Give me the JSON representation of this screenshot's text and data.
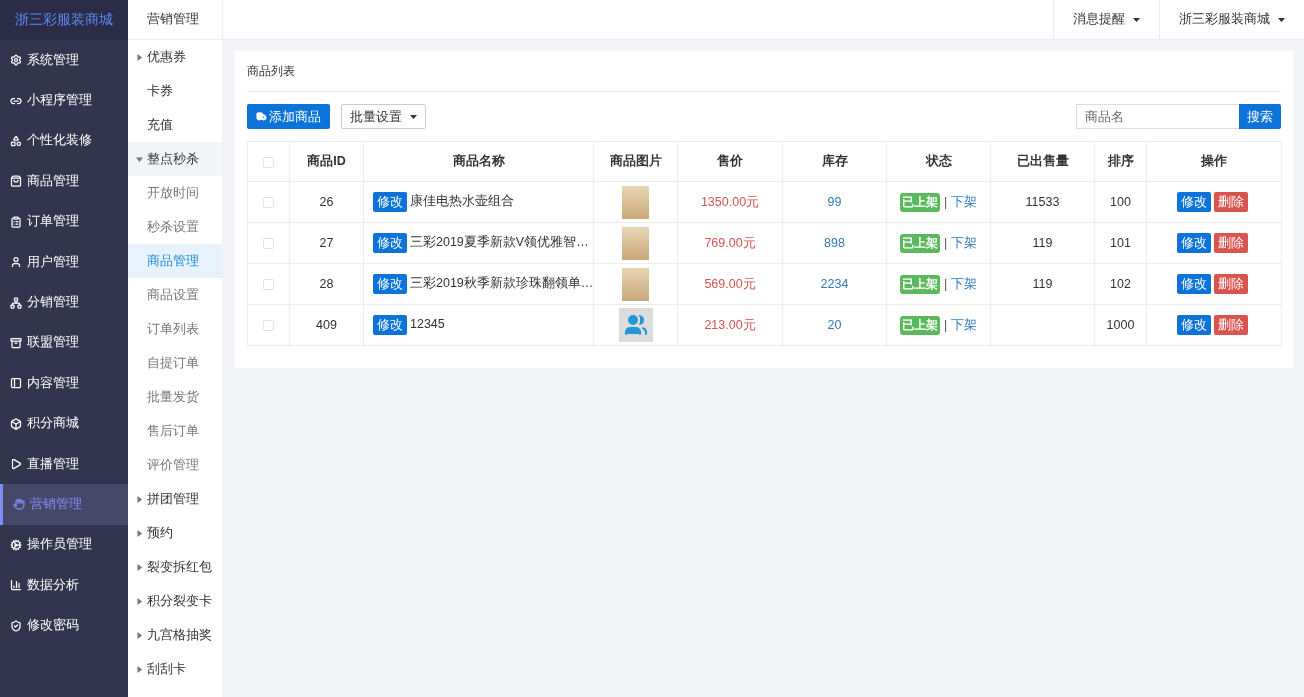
{
  "brand": "浙三彩服装商城",
  "sidebar": {
    "items": [
      {
        "label": "系统管理",
        "selected": false
      },
      {
        "label": "小程序管理",
        "selected": false
      },
      {
        "label": "个性化装修",
        "selected": false
      },
      {
        "label": "商品管理",
        "selected": false
      },
      {
        "label": "订单管理",
        "selected": false
      },
      {
        "label": "用户管理",
        "selected": false
      },
      {
        "label": "分销管理",
        "selected": false
      },
      {
        "label": "联盟管理",
        "selected": false
      },
      {
        "label": "内容管理",
        "selected": false
      },
      {
        "label": "积分商城",
        "selected": false
      },
      {
        "label": "直播管理",
        "selected": false
      },
      {
        "label": "营销管理",
        "selected": true
      },
      {
        "label": "操作员管理",
        "selected": false
      },
      {
        "label": "数据分析",
        "selected": false
      },
      {
        "label": "修改密码",
        "selected": false
      }
    ]
  },
  "submenu": {
    "title": "营销管理",
    "items": [
      {
        "kind": "group",
        "label": "优惠券",
        "expanded": false
      },
      {
        "kind": "link",
        "label": "卡券",
        "selected": false
      },
      {
        "kind": "link",
        "label": "充值",
        "selected": false
      },
      {
        "kind": "group",
        "label": "整点秒杀",
        "expanded": true,
        "children": [
          {
            "label": "开放时间",
            "selected": false
          },
          {
            "label": "秒杀设置",
            "selected": false
          },
          {
            "label": "商品管理",
            "selected": true
          },
          {
            "label": "商品设置",
            "selected": false
          },
          {
            "label": "订单列表",
            "selected": false
          },
          {
            "label": "自提订单",
            "selected": false
          },
          {
            "label": "批量发货",
            "selected": false
          },
          {
            "label": "售后订单",
            "selected": false
          },
          {
            "label": "评价管理",
            "selected": false
          }
        ]
      },
      {
        "kind": "group",
        "label": "拼团管理",
        "expanded": false
      },
      {
        "kind": "group",
        "label": "预约",
        "expanded": false
      },
      {
        "kind": "group",
        "label": "裂变拆红包",
        "expanded": false
      },
      {
        "kind": "group",
        "label": "积分裂变卡",
        "expanded": false
      },
      {
        "kind": "group",
        "label": "九宫格抽奖",
        "expanded": false
      },
      {
        "kind": "group",
        "label": "刮刮卡",
        "expanded": false
      }
    ]
  },
  "topbar": {
    "menus": [
      "消息提醒",
      "浙三彩服装商城"
    ]
  },
  "panel": {
    "title": "商品列表",
    "add_button": "添加商品",
    "batch_button": "批量设置",
    "search": {
      "placeholder": "商品名",
      "button": "搜索"
    },
    "table": {
      "all_checked": false,
      "columns": [
        "商品ID",
        "商品名称",
        "商品图片",
        "售价",
        "库存",
        "状态",
        "已出售量",
        "排序",
        "操作"
      ],
      "rows": [
        {
          "kind": "photo",
          "checked": false,
          "id": "26",
          "edit": "修改",
          "name": "康佳电热水壶组合",
          "price": "1350.00元",
          "stock": "99",
          "status": "已上架",
          "separator": "|",
          "toggle": "下架",
          "sold": "11533",
          "sort": "100",
          "actions": [
            "修改",
            "删除"
          ]
        },
        {
          "kind": "photo",
          "checked": false,
          "id": "27",
          "edit": "修改",
          "name": "三彩2019夏季新款V领优雅智…",
          "price": "769.00元",
          "stock": "898",
          "status": "已上架",
          "separator": "|",
          "toggle": "下架",
          "sold": "119",
          "sort": "101",
          "actions": [
            "修改",
            "删除"
          ]
        },
        {
          "kind": "photo",
          "checked": false,
          "id": "28",
          "edit": "修改",
          "name": "三彩2019秋季新款珍珠翻领单…",
          "price": "569.00元",
          "stock": "2234",
          "status": "已上架",
          "separator": "|",
          "toggle": "下架",
          "sold": "119",
          "sort": "102",
          "actions": [
            "修改",
            "删除"
          ]
        },
        {
          "kind": "avatar",
          "checked": false,
          "id": "409",
          "edit": "修改",
          "name": "12345",
          "price": "213.00元",
          "stock": "20",
          "status": "已上架",
          "separator": "|",
          "toggle": "下架",
          "sort": "1000",
          "actions": [
            "修改",
            "删除"
          ]
        }
      ]
    }
  }
}
